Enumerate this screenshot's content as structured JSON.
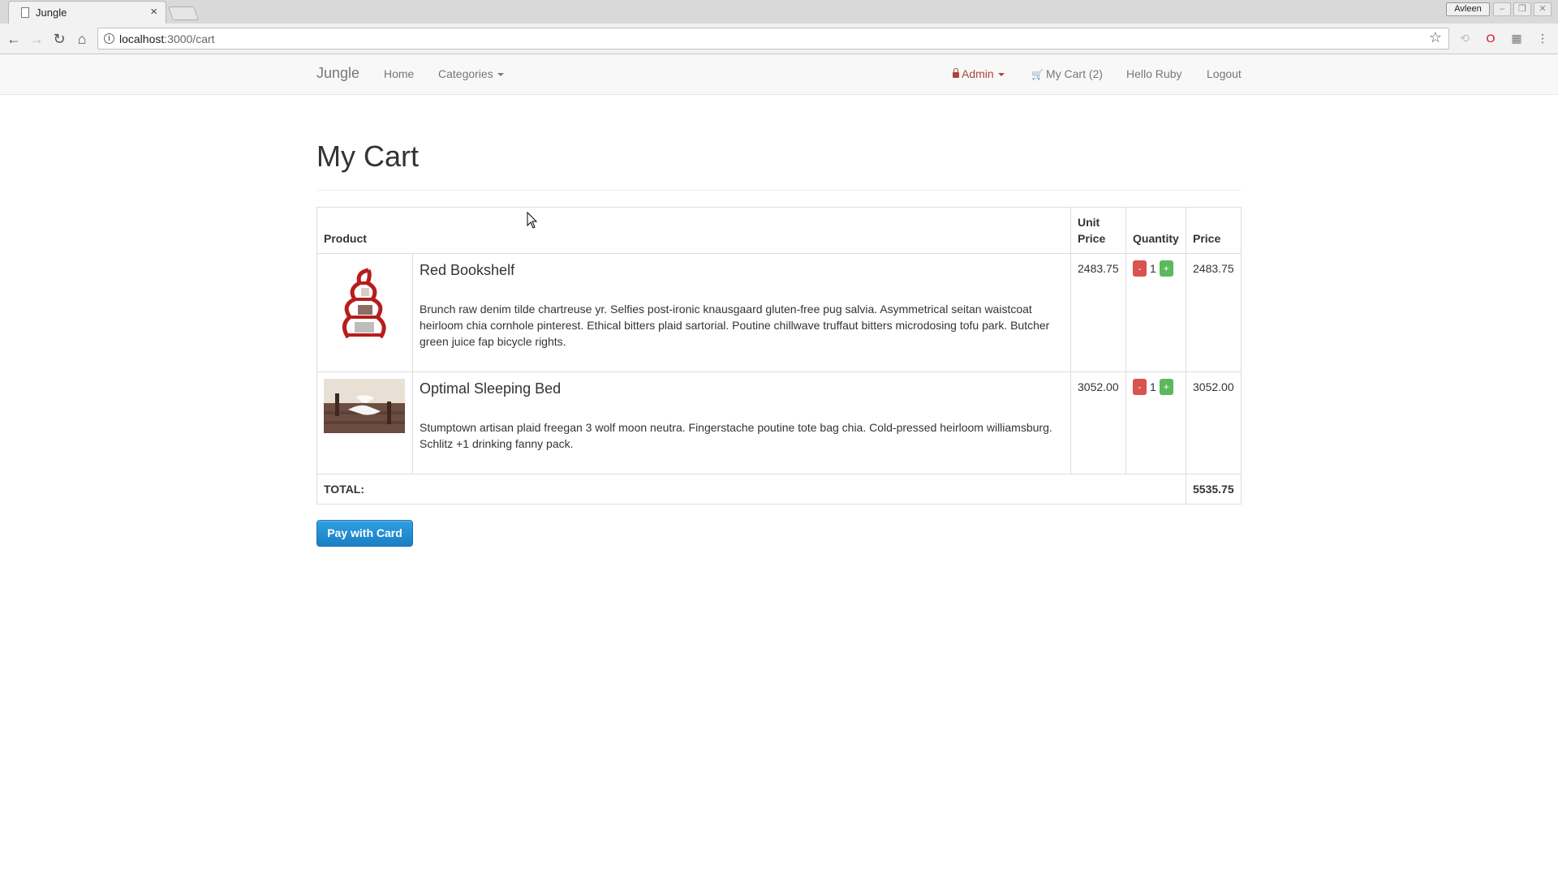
{
  "browser": {
    "tab_title": "Jungle",
    "tab_close": "×",
    "url_host": "localhost",
    "url_path": ":3000/cart",
    "profile_name": "Avleen"
  },
  "navbar": {
    "brand": "Jungle",
    "home": "Home",
    "categories": "Categories",
    "admin": "Admin",
    "my_cart": "My Cart (2)",
    "hello": "Hello Ruby",
    "logout": "Logout"
  },
  "page": {
    "title": "My Cart"
  },
  "table": {
    "headers": {
      "product": "Product",
      "unit_price": "Unit Price",
      "quantity": "Quantity",
      "price": "Price"
    },
    "rows": [
      {
        "name": "Red Bookshelf",
        "description": "Brunch raw denim tilde chartreuse yr. Selfies post-ironic knausgaard gluten-free pug salvia. Asymmetrical seitan waistcoat heirloom chia cornhole pinterest. Ethical bitters plaid sartorial. Poutine chillwave truffaut bitters microdosing tofu park. Butcher green juice fap bicycle rights.",
        "unit_price": "2483.75",
        "quantity": "1",
        "price": "2483.75"
      },
      {
        "name": "Optimal Sleeping Bed",
        "description": "Stumptown artisan plaid freegan 3 wolf moon neutra. Fingerstache poutine tote bag chia. Cold-pressed heirloom williamsburg. Schlitz +1 drinking fanny pack.",
        "unit_price": "3052.00",
        "quantity": "1",
        "price": "3052.00"
      }
    ],
    "minus_label": "-",
    "plus_label": "+",
    "total_label": "TOTAL:",
    "total_value": "5535.75"
  },
  "actions": {
    "pay": "Pay with Card"
  },
  "colors": {
    "admin": "#a94442",
    "minus": "#d9534f",
    "plus": "#5cb85c",
    "pay_button": "#1a7ec4"
  }
}
